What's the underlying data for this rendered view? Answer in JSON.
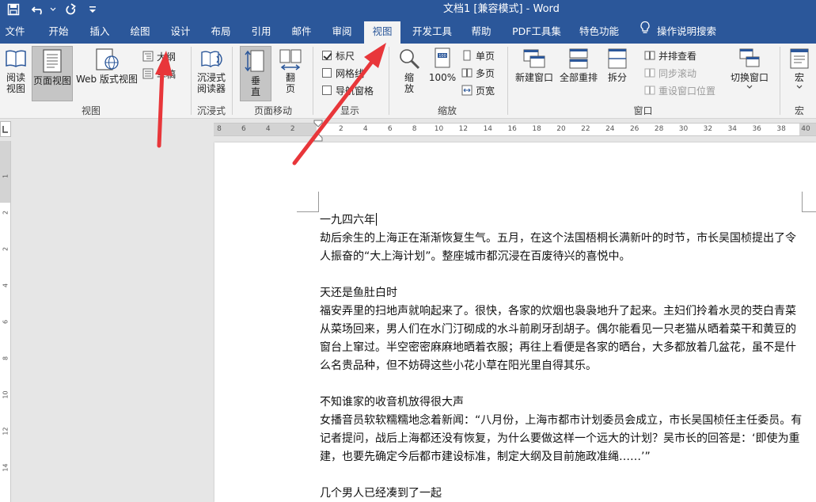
{
  "app": {
    "doc_title": "文档1 [兼容模式] - Word"
  },
  "quick_access": {
    "save_icon": "save-icon",
    "undo_icon": "undo-icon",
    "redo_icon": "redo-icon",
    "customize_icon": "customize-icon"
  },
  "tabs": {
    "file": "文件",
    "home": "开始",
    "insert": "插入",
    "draw": "绘图",
    "design": "设计",
    "layout": "布局",
    "references": "引用",
    "mailings": "邮件",
    "review": "审阅",
    "view": "视图",
    "developer": "开发工具",
    "help": "帮助",
    "pdf": "PDF工具集",
    "features": "特色功能",
    "tell_me": "操作说明搜索"
  },
  "ribbon": {
    "views": {
      "read_mode": "阅读\n视图",
      "print_layout": "页面视图",
      "web_layout": "Web 版式视图",
      "outline": "大纲",
      "draft": "草稿",
      "group_label": "视图"
    },
    "immersive": {
      "reader": "沉浸式\n阅读器",
      "group_label": "沉浸式"
    },
    "page_movement": {
      "vertical": "垂\n直",
      "side_to_side": "翻\n页",
      "group_label": "页面移动"
    },
    "show": {
      "ruler": "标尺",
      "ruler_checked": true,
      "gridlines": "网格线",
      "gridlines_checked": false,
      "nav_pane": "导航窗格",
      "nav_pane_checked": false,
      "group_label": "显示"
    },
    "zoom": {
      "zoom": "缩\n放",
      "hundred": "100%",
      "one_page": "单页",
      "multiple_pages": "多页",
      "page_width": "页宽",
      "group_label": "缩放"
    },
    "window": {
      "new_window": "新建窗口",
      "arrange_all": "全部重排",
      "split": "拆分",
      "side_by_side": "并排查看",
      "sync_scroll": "同步滚动",
      "reset_position": "重设窗口位置",
      "switch_windows": "切换窗口",
      "group_label": "窗口"
    },
    "macros": {
      "macros": "宏",
      "group_label": "宏"
    }
  },
  "ruler": {
    "h_ticks": [
      "8",
      "6",
      "4",
      "2",
      "2",
      "4",
      "6",
      "8",
      "10",
      "12",
      "14",
      "16",
      "18",
      "20",
      "22",
      "24",
      "26",
      "28",
      "30",
      "32",
      "34",
      "36",
      "38",
      "40"
    ],
    "v_ticks": [
      "1",
      "2",
      "2",
      "4",
      "6",
      "8",
      "10",
      "12",
      "14"
    ]
  },
  "document": {
    "paragraphs": [
      "一九四六年",
      "劫后余生的上海正在渐渐恢复生气。五月，在这个法国梧桐长满新叶的时节，市长吴国桢提出了令人振奋的“大上海计划”。整座城市都沉浸在百废待兴的喜悦中。",
      "天还是鱼肚白时",
      "福安弄里的扫地声就响起来了。很快，各家的炊烟也袅袅地升了起来。主妇们拎着水灵的茭白青菜从菜场回来，男人们在水门汀砌成的水斗前刷牙刮胡子。偶尔能看见一只老猫从晒着菜干和黄豆的窗台上窜过。半空密密麻麻地晒着衣服；再往上看便是各家的晒台，大多都放着几盆花，虽不是什么名贵品种，但不妨碍这些小花小草在阳光里自得其乐。",
      "不知谁家的收音机放得很大声",
      "女播音员软软糯糯地念着新闻：“八月份，上海市都市计划委员会成立，市长吴国桢任主任委员。有记者提问，战后上海都还没有恢复，为什么要做这样一个远大的计划？吴市长的回答是：‘即使为重建，也要先确定今后都市建设标准，制定大纲及目前施政准绳……’”",
      "几个男人已经凑到了一起"
    ]
  },
  "colors": {
    "word_blue": "#2b579a",
    "annotation_red": "#e8363a"
  }
}
